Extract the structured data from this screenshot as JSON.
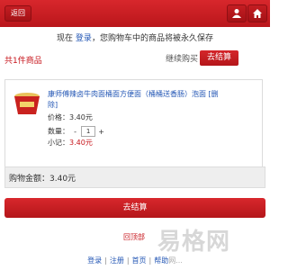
{
  "header": {
    "back_label": "返回",
    "user_icon": "user-icon",
    "home_icon": "home-icon",
    "brand_color": "#c7161c"
  },
  "notice": {
    "prefix": "现在",
    "login_link": "登录",
    "suffix": "，您购物车中的商品将被永久保存"
  },
  "summary": {
    "count_text": "共1件商品",
    "continue_label": "继续购买",
    "checkout_label": "去结算"
  },
  "product": {
    "name": "康师傅辣卤牛肉面桶面方便面（桶桶送香肠）泡面",
    "delete_label": "[删除]",
    "price_label": "价格：",
    "price_value": "3.40元",
    "qty_label": "数量：",
    "qty_minus": "-",
    "qty_value": "1",
    "qty_plus": "+",
    "subtotal_label": "小记：",
    "subtotal_value": "3.40元"
  },
  "total": {
    "text": "购物金额：3.40元"
  },
  "actions": {
    "checkout_big": "去结算",
    "back_to_top": "回顶部"
  },
  "footer": {
    "links": [
      "登录",
      "注册",
      "首页",
      "帮助"
    ],
    "tail": "网..."
  },
  "watermark": "易格网"
}
